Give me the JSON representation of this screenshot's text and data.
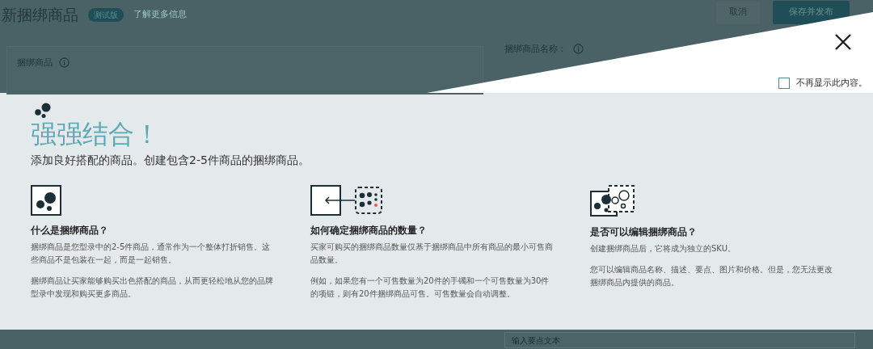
{
  "page": {
    "title": "新捆绑商品",
    "badge": "测试版",
    "learn_more": "了解更多信息",
    "buttons": [
      {
        "label": "取消",
        "kind": "secondary"
      },
      {
        "label": "保存并发布",
        "kind": "primary"
      }
    ],
    "bundle_section": {
      "label": "捆绑商品"
    },
    "name_field": {
      "label": "捆绑商品名称："
    },
    "bullet_field": {
      "placeholder": "输入要点文本"
    }
  },
  "modal": {
    "dont_show_again": {
      "label": "不再显示此内容。",
      "checked": false
    },
    "title": "强强结合！",
    "subtitle": "添加良好搭配的商品。创建包含2-5件商品的捆绑商品。",
    "sections": [
      {
        "kind": "bundle",
        "heading": "什么是捆绑商品？",
        "paragraphs": [
          "捆绑商品是您型录中的2-5件商品，通常作为一个整体打折销售。这些商品不是包装在一起，而是一起销售。",
          "捆绑商品让买家能够购买出色搭配的商品，从而更轻松地从您的品牌型录中发现和购买更多商品。"
        ]
      },
      {
        "kind": "quantity",
        "heading": "如何确定捆绑商品的数量？",
        "paragraphs": [
          "买家可购买的捆绑商品数量仅基于捆绑商品中所有商品的最小可售商品数量。",
          "例如，如果您有一个可售数量为20件的手镯和一个可售数量为30件的项链，则有20件捆绑商品可售。可售数量会自动调整。"
        ]
      },
      {
        "kind": "edit",
        "heading": "是否可以编辑捆绑商品？",
        "paragraphs": [
          "创建捆绑商品后，它将成为独立的SKU。",
          "您可以编辑商品名称、描述、要点、图片和价格。但是，您无法更改捆绑商品内提供的商品。"
        ]
      }
    ]
  }
}
